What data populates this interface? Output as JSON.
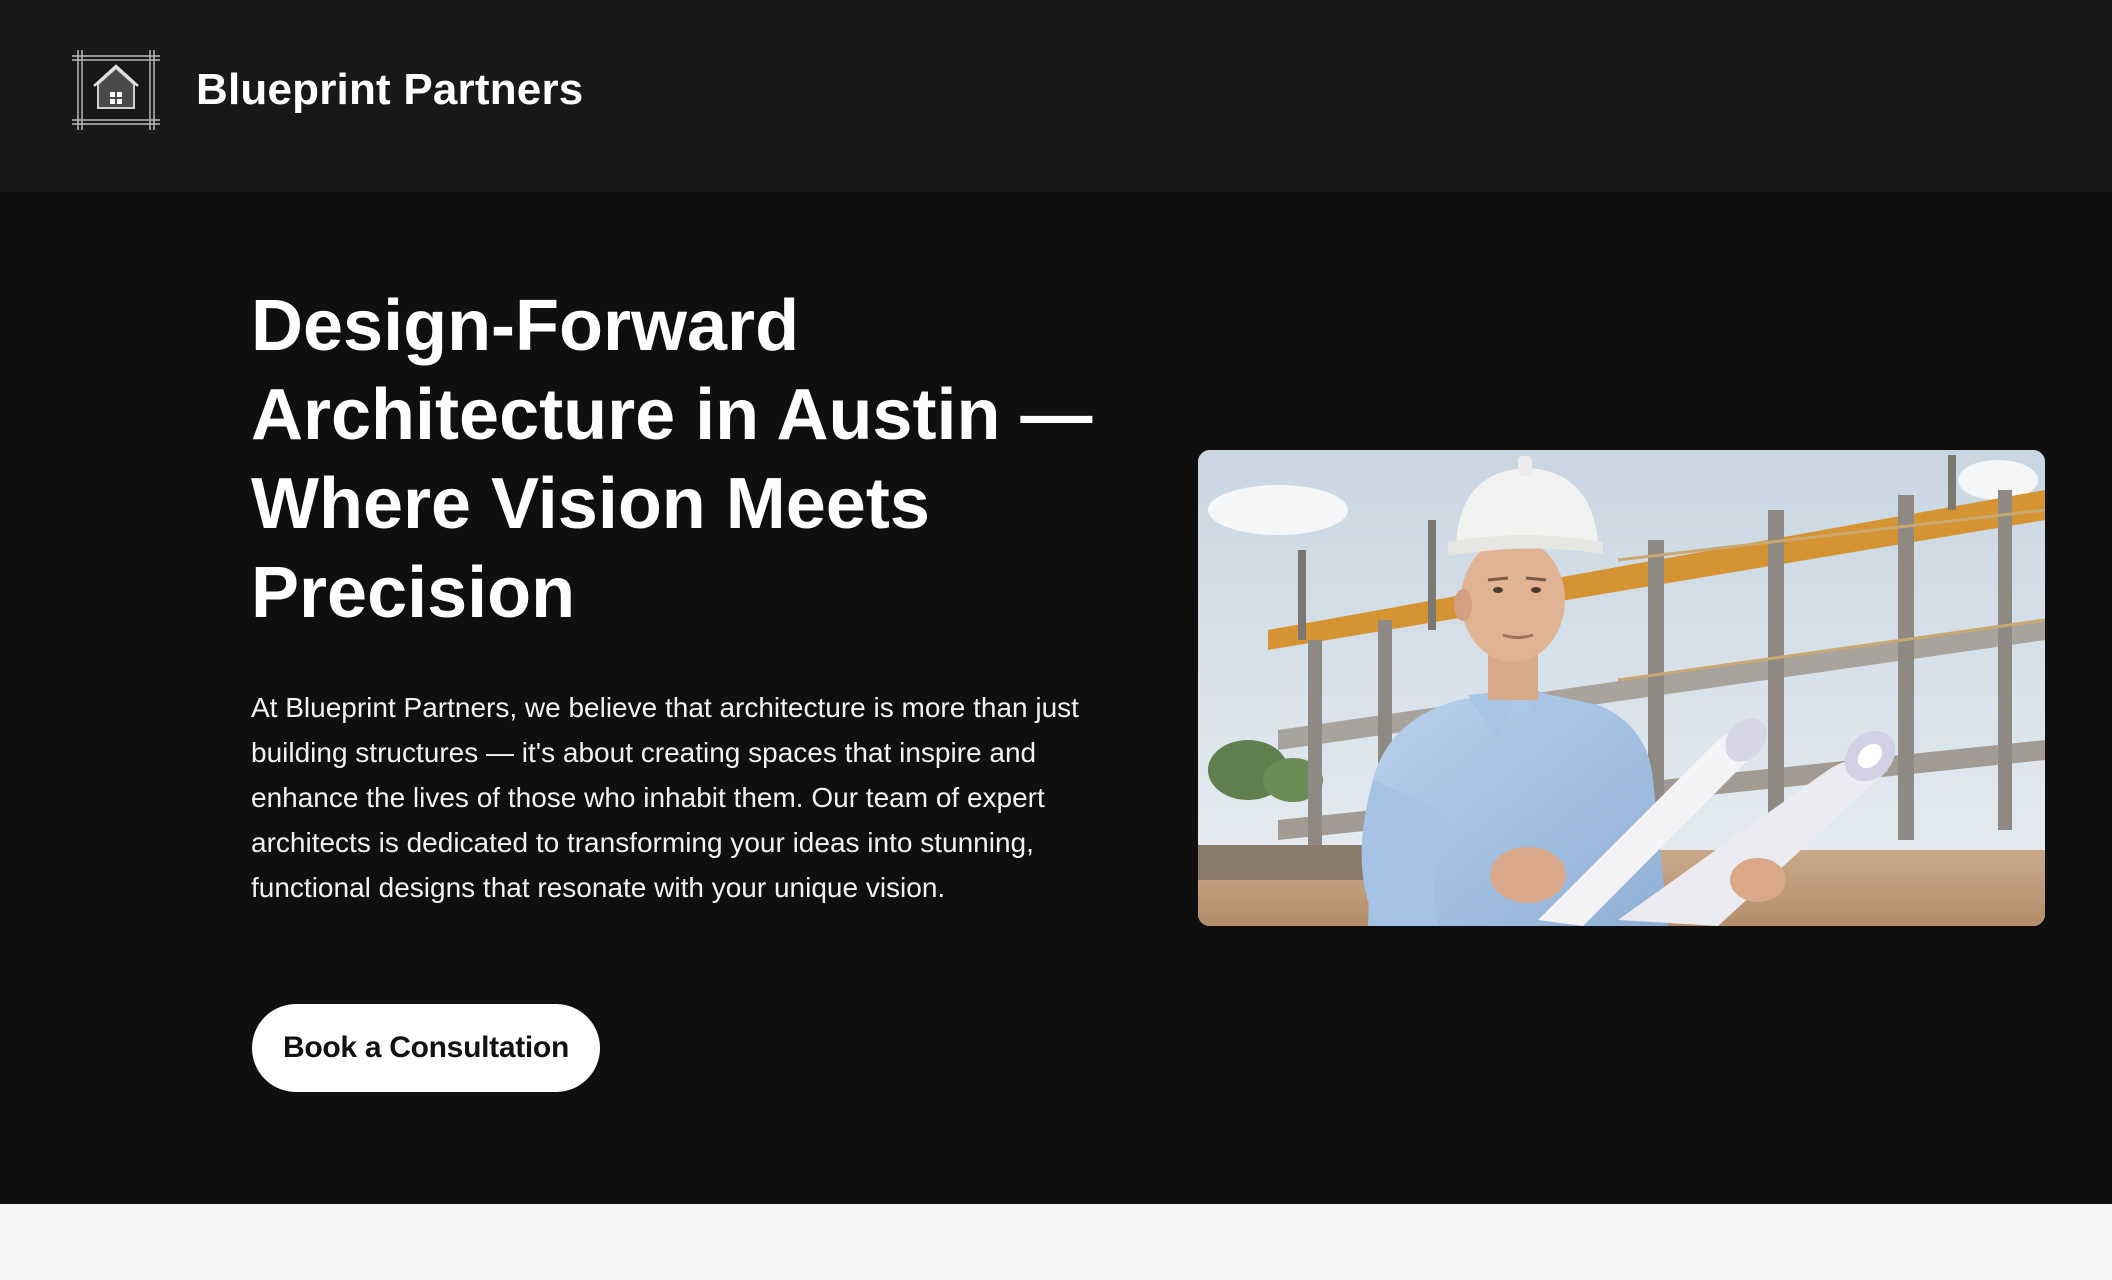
{
  "header": {
    "brand_name": "Blueprint Partners",
    "logo_icon": "house-blueprint-icon"
  },
  "hero": {
    "title": "Design-Forward Architecture in Austin — Where Vision Meets Precision",
    "description": "At Blueprint Partners, we believe that architecture is more than just building structures — it's about creating spaces that inspire and enhance the lives of those who inhabit them. Our team of expert architects is dedicated to transforming your ideas into stunning, functional designs that resonate with your unique vision.",
    "cta_label": "Book a Consultation",
    "image_subject": "architect-holding-blueprints-photo"
  },
  "colors": {
    "header_bg": "#181818",
    "hero_bg": "#0f0f0f",
    "button_bg": "#ffffff",
    "button_text": "#111111",
    "next_section_bg": "#f6f6f6"
  }
}
